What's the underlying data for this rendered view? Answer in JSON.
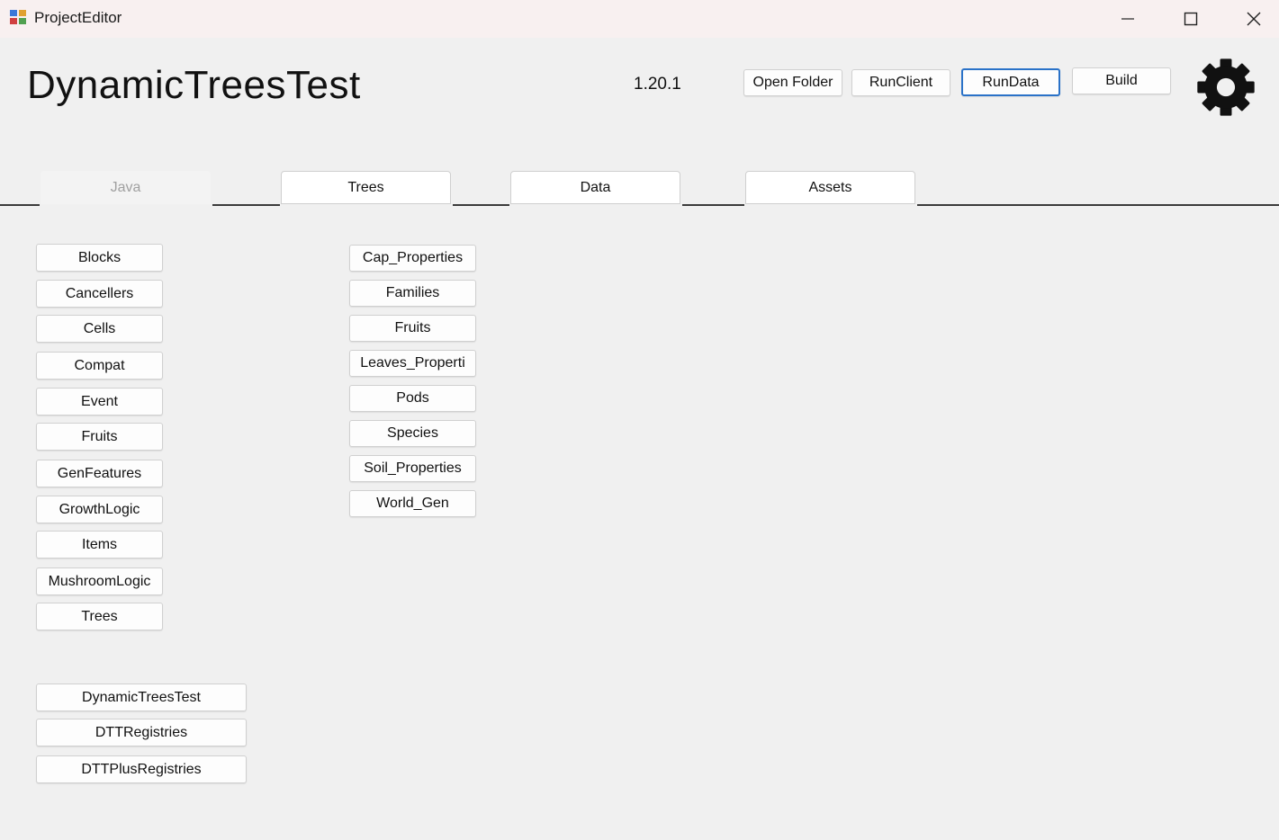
{
  "window": {
    "title": "ProjectEditor",
    "controls": [
      "minimize",
      "maximize",
      "close"
    ]
  },
  "header": {
    "project_title": "DynamicTreesTest",
    "version": "1.20.1",
    "buttons": {
      "open_folder": "Open Folder",
      "run_client": "RunClient",
      "run_data": "RunData",
      "build": "Build"
    },
    "settings_icon": "gear-icon"
  },
  "tabs": [
    {
      "label": "Java",
      "active": true
    },
    {
      "label": "Trees",
      "active": false
    },
    {
      "label": "Data",
      "active": false
    },
    {
      "label": "Assets",
      "active": false
    }
  ],
  "java_packages": [
    "Blocks",
    "Cancellers",
    "Cells",
    "Compat",
    "Event",
    "Fruits",
    "GenFeatures",
    "GrowthLogic",
    "Items",
    "MushroomLogic",
    "Trees"
  ],
  "tree_properties": [
    "Cap_Properties",
    "Families",
    "Fruits",
    "Leaves_Properti",
    "Pods",
    "Species",
    "Soil_Properties",
    "World_Gen"
  ],
  "java_classes": [
    "DynamicTreesTest",
    "DTTRegistries",
    "DTTPlusRegistries"
  ],
  "colors": {
    "background": "#f0f0f0",
    "titlebar": "#f8f0f0",
    "focus_border": "#2a72c8",
    "inactive_tab_text": "#a0a0a0"
  }
}
